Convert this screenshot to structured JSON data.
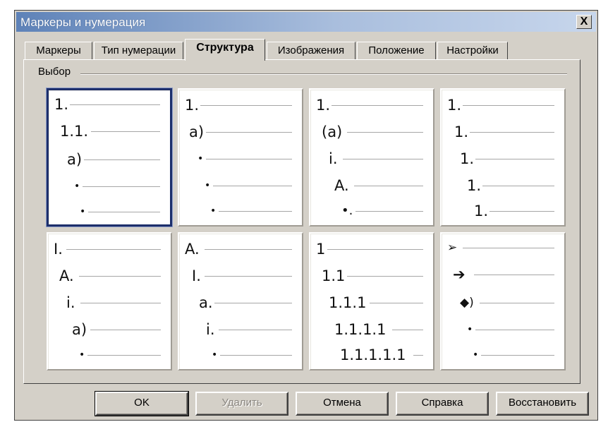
{
  "window": {
    "title": "Маркеры и нумерация",
    "close_glyph": "X"
  },
  "tabs": [
    {
      "label": "Маркеры",
      "active": false
    },
    {
      "label": "Тип нумерации",
      "active": false
    },
    {
      "label": "Структура",
      "active": true
    },
    {
      "label": "Изображения",
      "active": false
    },
    {
      "label": "Положение",
      "active": false
    },
    {
      "label": "Настройки",
      "active": false
    }
  ],
  "group": {
    "label": "Выбор"
  },
  "options": [
    {
      "selected": true,
      "levels": [
        "1.",
        "1.1.",
        "a)",
        "•",
        "•"
      ]
    },
    {
      "selected": false,
      "levels": [
        "1.",
        "a)",
        "•",
        "•",
        "•"
      ]
    },
    {
      "selected": false,
      "levels": [
        "1.",
        "(a)",
        "i.",
        "A.",
        "•."
      ]
    },
    {
      "selected": false,
      "levels": [
        "1.",
        "1.",
        "1.",
        "1.",
        "1."
      ]
    },
    {
      "selected": false,
      "levels": [
        "I.",
        "A.",
        "i.",
        "a)",
        "•"
      ]
    },
    {
      "selected": false,
      "levels": [
        "A.",
        "I.",
        "a.",
        "i.",
        "•"
      ]
    },
    {
      "selected": false,
      "levels": [
        "1",
        "1.1",
        "1.1.1",
        "1.1.1.1",
        "1.1.1.1.1"
      ]
    },
    {
      "selected": false,
      "levels": [
        "➢",
        "➔",
        "◆)",
        "•",
        "•"
      ]
    }
  ],
  "buttons": {
    "ok": "OK",
    "delete": "Удалить",
    "cancel": "Отмена",
    "help": "Справка",
    "reset": "Восстановить"
  }
}
